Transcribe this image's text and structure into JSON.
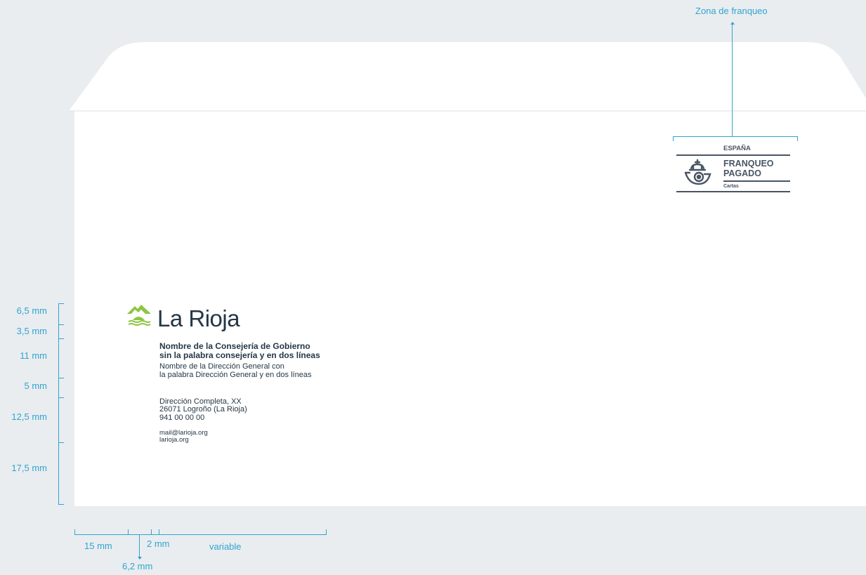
{
  "postage_zone": {
    "label": "Zona de franqueo"
  },
  "stamp": {
    "country": "ESPAÑA",
    "line1": "FRANQUEO",
    "line2": "PAGADO",
    "category": "Cartas",
    "icon": "post-horn-crown-icon"
  },
  "logo": {
    "text": "La Rioja",
    "icon": "la-rioja-mountain-logo",
    "colors": {
      "green": "#8cc63f",
      "dark": "#253746"
    }
  },
  "sender": {
    "department_line1": "Nombre de la Consejería de Gobierno",
    "department_line2": "sin la palabra consejería y en dos líneas",
    "directorate_line1": "Nombre de la Dirección General con",
    "directorate_line2": "la palabra Dirección General y en dos líneas",
    "address_line1": "Dirección Completa, XX",
    "address_line2": "26071 Logroño (La Rioja)",
    "phone": "941 00 00 00",
    "email": "mail@larioja.org",
    "website": "larioja.org"
  },
  "vertical_measures": [
    "6,5 mm",
    "3,5 mm",
    "11 mm",
    "5 mm",
    "12,5 mm",
    "17,5 mm"
  ],
  "horizontal_measures": {
    "left_margin": "15 mm",
    "gap_small": "2 mm",
    "text_width": "variable",
    "logo_offset": "6,2 mm"
  },
  "colors": {
    "background": "#e9edf0",
    "envelope": "#ffffff",
    "dimension": "#31a4cf",
    "text": "#253746",
    "stamp": "#4a5563"
  }
}
